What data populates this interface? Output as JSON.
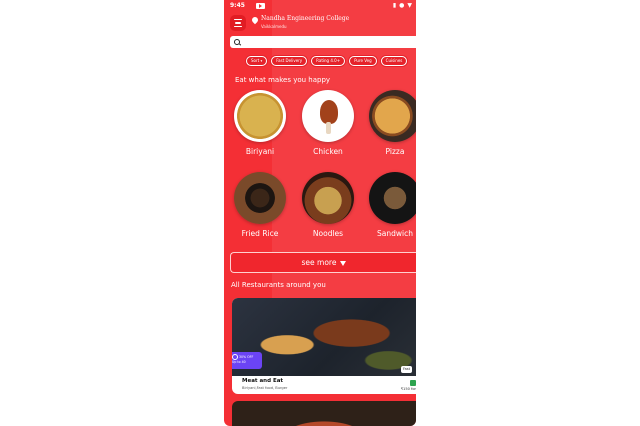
{
  "status_bar": {
    "time": "9:45",
    "icons": [
      "battery-icon",
      "location-icon",
      "wifi-icon"
    ]
  },
  "header": {
    "location_title": "Nandha Engineering College",
    "location_subtitle": "Vaikkalmedu"
  },
  "search": {
    "placeholder": ""
  },
  "filters": [
    {
      "label": "Sort",
      "dropdown": true
    },
    {
      "label": "Fast Delivery"
    },
    {
      "label": "Rating 4.0+"
    },
    {
      "label": "Pure Veg"
    },
    {
      "label": "Cuisines"
    }
  ],
  "sections": {
    "categories_title": "Eat what makes you happy",
    "restaurants_title": "All Restaurants around you"
  },
  "categories": [
    {
      "label": "Biriyani"
    },
    {
      "label": "Chicken"
    },
    {
      "label": "Pizza"
    },
    {
      "label": "Fried Rice"
    },
    {
      "label": "Noodles"
    },
    {
      "label": "Sandwich"
    }
  ],
  "see_more": {
    "label": "see more"
  },
  "restaurant_card": {
    "offer_line1": "30% OFF",
    "offer_line2": "Up to 40",
    "badge": "Fast",
    "name": "Meat and Eat",
    "cuisine": "Biriyani,Fast food, Burger",
    "price": "₹150 for"
  },
  "colors": {
    "brand": "#f42f35",
    "offer": "#6b44f5",
    "rating": "#2ea44f"
  }
}
